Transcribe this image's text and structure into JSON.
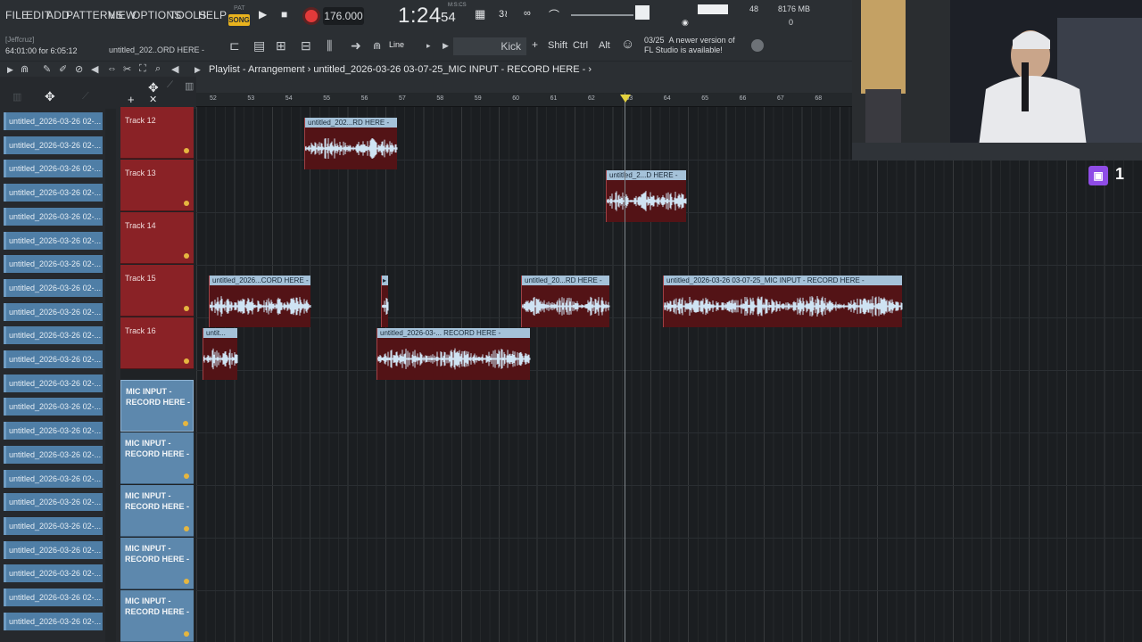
{
  "menu": [
    "FILE",
    "EDIT",
    "ADD",
    "PATTERNS",
    "VIEW",
    "OPTIONS",
    "TOOLS",
    "HELP"
  ],
  "transport": {
    "pat_label": "PAT",
    "song_label": "SONG",
    "tempo": "176.000",
    "clock_main": "1:24",
    "clock_sec": "54",
    "clock_unit": "M:S:CS",
    "cpu": "48",
    "memory": "8176 MB",
    "polyphony": "0"
  },
  "toolbar": {
    "user": "[Jeffcruz]",
    "user_time": "64:01:00 for 6:05:12",
    "project": "untitled_202..ORD HERE -",
    "snap": "Line",
    "channel": "Kick",
    "keys": [
      "Shift",
      "Ctrl",
      "Alt"
    ],
    "update_date": "03/25",
    "update_line1": "A newer version of",
    "update_line2": "FL Studio is available!"
  },
  "playlist": {
    "title": "Playlist - Arrangement",
    "sep": "›",
    "pattern": "untitled_2026-03-26 03-07-25_MIC INPUT - RECORD HERE -",
    "ruler": [
      "52",
      "53",
      "54",
      "55",
      "56",
      "57",
      "58",
      "59",
      "60",
      "61",
      "62",
      "63",
      "64",
      "65",
      "66",
      "67",
      "68"
    ]
  },
  "browser_items": [
    "untitled_2026-03-26 02-...",
    "untitled_2026-03-26 02-...",
    "untitled_2026-03-26 02-...",
    "untitled_2026-03-26 02-...",
    "untitled_2026-03-26 02-...",
    "untitled_2026-03-26 02-...",
    "untitled_2026-03-26 02-...",
    "untitled_2026-03-26 02-...",
    "untitled_2026-03-26 02-...",
    "untitled_2026-03-26 02-...",
    "untitled_2026-03-26 02-...",
    "untitled_2026-03-26 02-...",
    "untitled_2026-03-26 02-...",
    "untitled_2026-03-26 02-...",
    "untitled_2026-03-26 02-...",
    "untitled_2026-03-26 02-...",
    "untitled_2026-03-26 02-...",
    "untitled_2026-03-26 02-...",
    "untitled_2026-03-26 02-...",
    "untitled_2026-03-26 02-...",
    "untitled_2026-03-26 02-...",
    "untitled_2026-03-26 02-..."
  ],
  "tracks": [
    "Track 12",
    "Track 13",
    "Track 14",
    "Track 15",
    "Track 16"
  ],
  "mic_tracks": [
    "MIC INPUT -\nRECORD HERE -",
    "MIC INPUT -\nRECORD HERE -",
    "MIC INPUT -\nRECORD HERE -",
    "MIC INPUT -\nRECORD HERE -",
    "MIC INPUT -\nRECORD HERE -"
  ],
  "clips": [
    "untitled_202...RD HERE -",
    "untitled_2...D HERE -",
    "untitled_2026...CORD HERE -",
    "untitled_20...RD HERE -",
    "untitled_2026-03-26 03-07-25_MIC INPUT - RECORD HERE -",
    "untit...",
    "untitled_2026-03-... RECORD HERE -"
  ],
  "stream": {
    "viewers": "1"
  },
  "colors": {
    "track": "#8a2226",
    "clip_header": "#a5c2d9",
    "pattern": "#4f7ea6",
    "record": "#e23a3a"
  }
}
